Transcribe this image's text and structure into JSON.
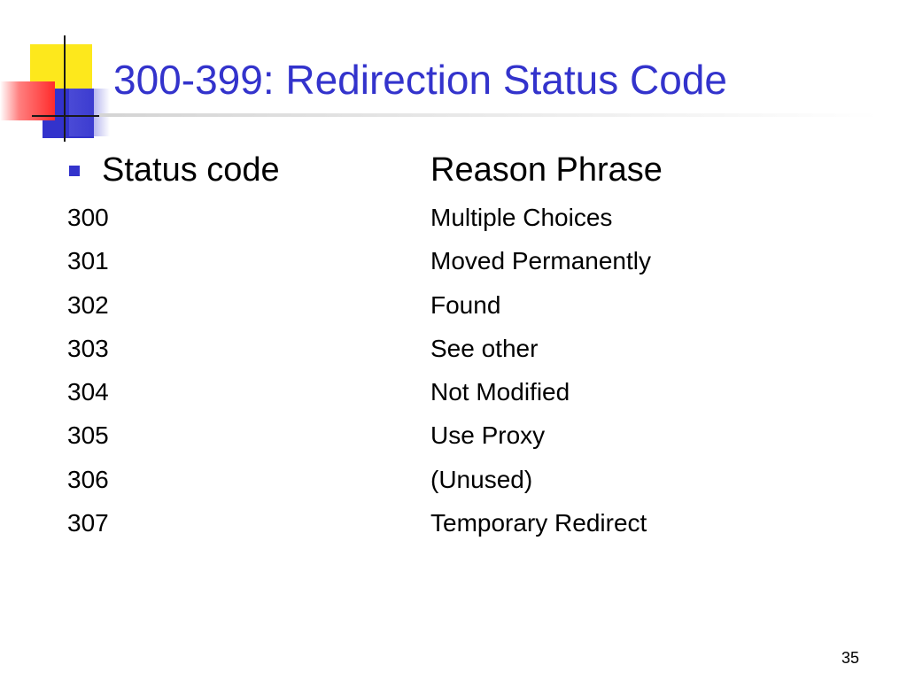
{
  "slide": {
    "title": "300-399: Redirection Status Code",
    "page_number": "35",
    "accent_color": "#3333cc",
    "header": {
      "code_label": "Status code",
      "reason_label": "Reason Phrase"
    },
    "rows": [
      {
        "code": "300",
        "reason": "Multiple Choices"
      },
      {
        "code": "301",
        "reason": "Moved Permanently"
      },
      {
        "code": "302",
        "reason": "Found"
      },
      {
        "code": "303",
        "reason": "See other"
      },
      {
        "code": "304",
        "reason": "Not Modified"
      },
      {
        "code": "305",
        "reason": "Use Proxy"
      },
      {
        "code": "306",
        "reason": "(Unused)"
      },
      {
        "code": "307",
        "reason": "Temporary Redirect"
      }
    ]
  }
}
